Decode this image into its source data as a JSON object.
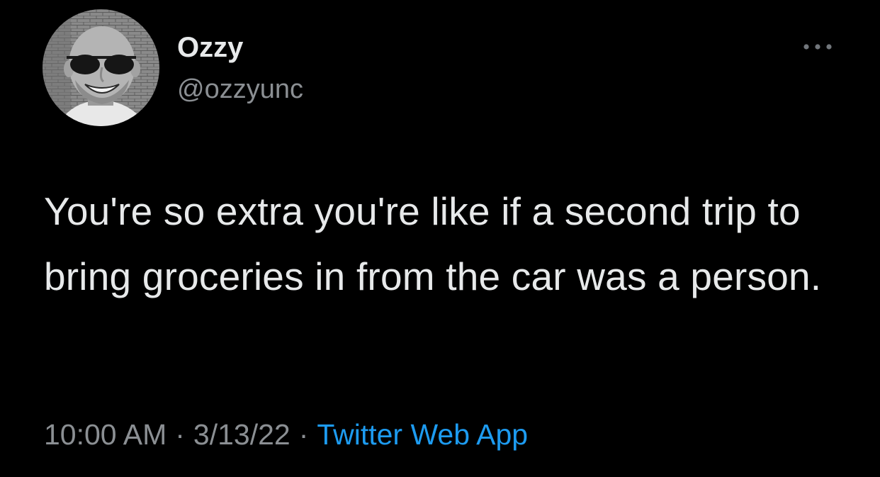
{
  "author": {
    "display_name": "Ozzy",
    "handle": "@ozzyunc"
  },
  "tweet": {
    "text": "You're so extra you're like if a second trip to bring groceries in from the car was a person."
  },
  "meta": {
    "time": "10:00 AM",
    "separator": "·",
    "date": "3/13/22",
    "source": "Twitter Web App"
  },
  "colors": {
    "background": "#000000",
    "primary_text": "#e7e9ea",
    "secondary_text": "#8b8f93",
    "link": "#1d9bf0"
  },
  "icons": {
    "more": "more-horizontal-icon",
    "avatar": "profile-photo"
  }
}
